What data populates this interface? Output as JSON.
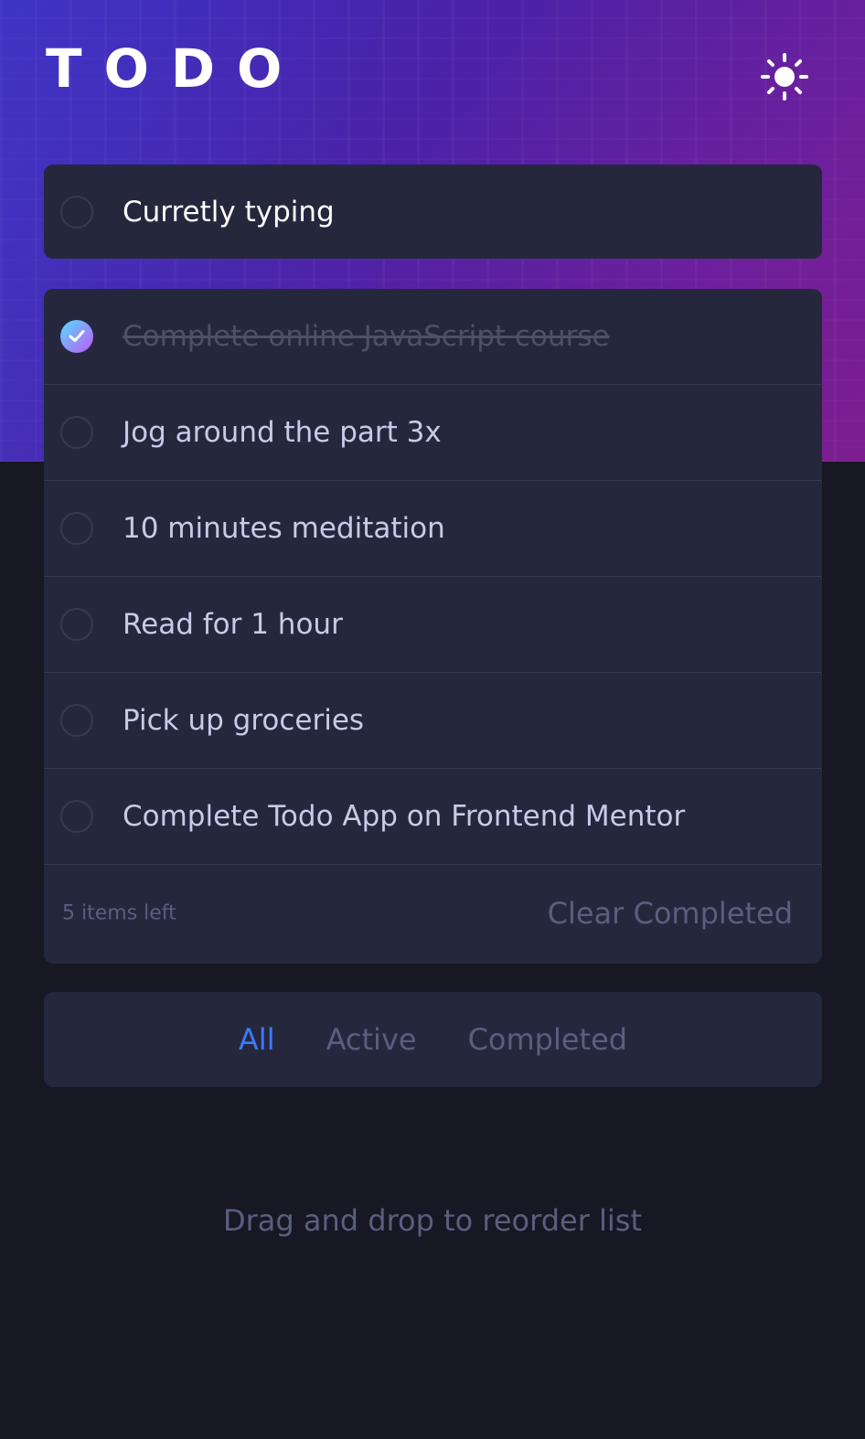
{
  "header": {
    "title": "TODO",
    "theme_icon": "sun-icon"
  },
  "new_todo": {
    "value": "Curretly typing"
  },
  "todos": [
    {
      "text": "Complete online JavaScript course",
      "completed": true
    },
    {
      "text": "Jog around the part 3x",
      "completed": false
    },
    {
      "text": "10 minutes meditation",
      "completed": false
    },
    {
      "text": "Read for 1 hour",
      "completed": false
    },
    {
      "text": "Pick up groceries",
      "completed": false
    },
    {
      "text": "Complete Todo App on Frontend Mentor",
      "completed": false
    }
  ],
  "footer": {
    "items_left": "5 items left",
    "clear_label": "Clear Completed"
  },
  "filters": {
    "all": "All",
    "active": "Active",
    "completed": "Completed",
    "selected": "All"
  },
  "hint": "Drag and drop to reorder list",
  "colors": {
    "background": "#171823",
    "card": "#25273d",
    "accent": "#3a7cfd",
    "check_gradient_start": "#55ddff",
    "check_gradient_end": "#c058f3"
  }
}
